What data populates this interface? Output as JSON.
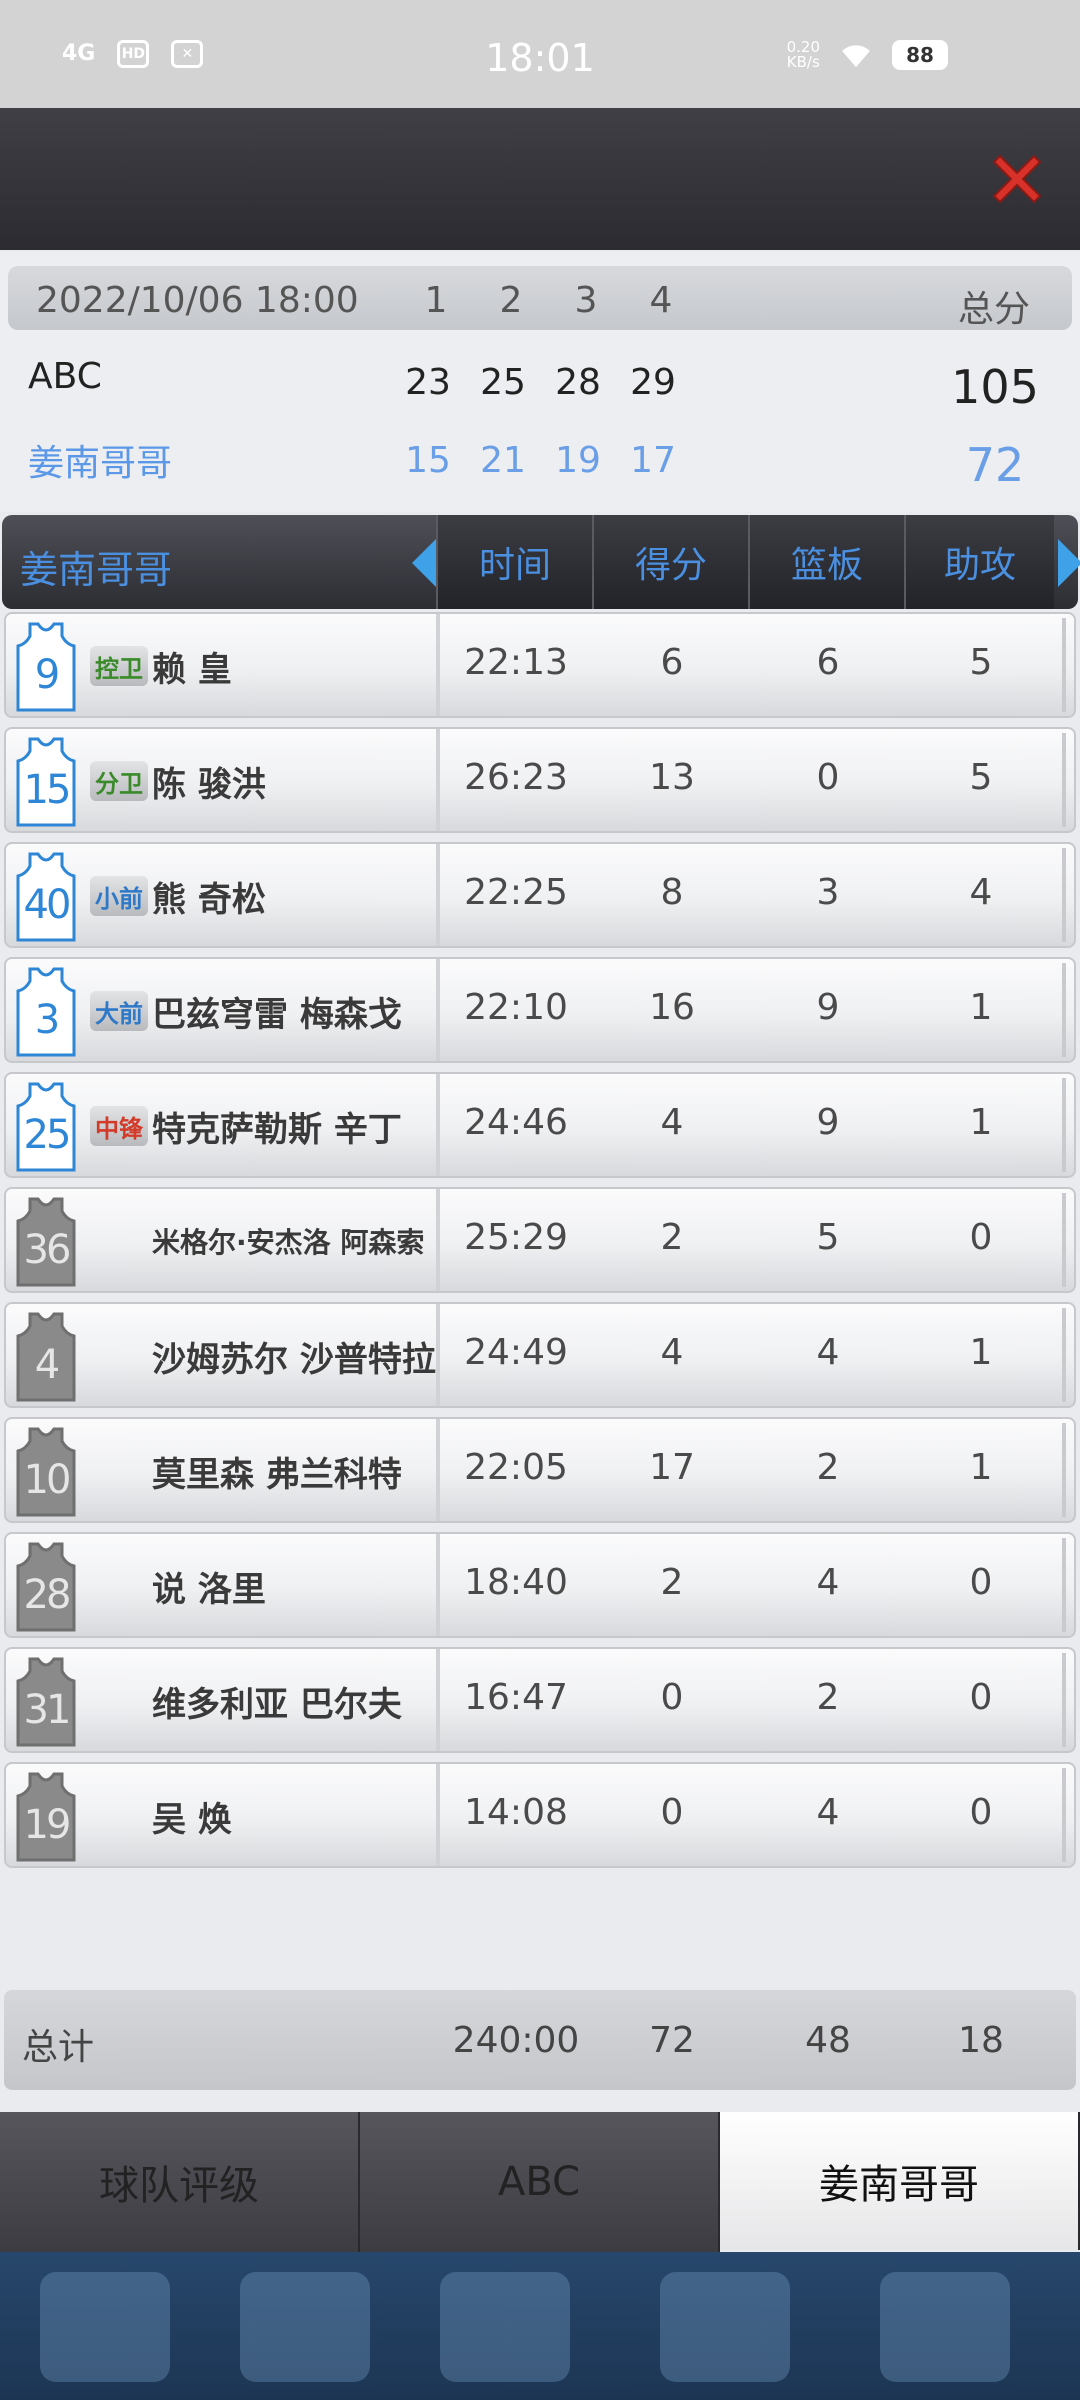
{
  "status_bar": {
    "network": "4G",
    "hd_label": "HD",
    "time": "18:01",
    "speed_value": "0.20",
    "speed_unit": "KB/s",
    "battery": "88"
  },
  "score_header": {
    "date": "2022/10/06 18:00",
    "quarters": [
      "1",
      "2",
      "3",
      "4"
    ],
    "total_label": "总分"
  },
  "teams": [
    {
      "name": "ABC",
      "quarters": [
        "23",
        "25",
        "28",
        "29"
      ],
      "total": "105"
    },
    {
      "name": "姜南哥哥",
      "quarters": [
        "15",
        "21",
        "19",
        "17"
      ],
      "total": "72"
    }
  ],
  "stats_header": {
    "team": "姜南哥哥",
    "columns": [
      "时间",
      "得分",
      "篮板",
      "助攻"
    ]
  },
  "players": [
    {
      "number": "9",
      "starter": true,
      "position": "控卫",
      "position_color": "#3a8a2a",
      "name": "赖 皇",
      "time": "22:13",
      "points": "6",
      "rebounds": "6",
      "assists": "5"
    },
    {
      "number": "15",
      "starter": true,
      "position": "分卫",
      "position_color": "#3a8a2a",
      "name": "陈 骏洪",
      "time": "26:23",
      "points": "13",
      "rebounds": "0",
      "assists": "5"
    },
    {
      "number": "40",
      "starter": true,
      "position": "小前",
      "position_color": "#2e78c8",
      "name": "熊 奇松",
      "time": "22:25",
      "points": "8",
      "rebounds": "3",
      "assists": "4"
    },
    {
      "number": "3",
      "starter": true,
      "position": "大前",
      "position_color": "#2e78c8",
      "name": "巴兹穹雷 梅森戈",
      "time": "22:10",
      "points": "16",
      "rebounds": "9",
      "assists": "1"
    },
    {
      "number": "25",
      "starter": true,
      "position": "中锋",
      "position_color": "#d33a2a",
      "name": "特克萨勒斯 辛丁",
      "time": "24:46",
      "points": "4",
      "rebounds": "9",
      "assists": "1"
    },
    {
      "number": "36",
      "starter": false,
      "position": "",
      "name": "米格尔·安杰洛 阿森索",
      "time": "25:29",
      "points": "2",
      "rebounds": "5",
      "assists": "0"
    },
    {
      "number": "4",
      "starter": false,
      "position": "",
      "name": "沙姆苏尔 沙普特拉",
      "time": "24:49",
      "points": "4",
      "rebounds": "4",
      "assists": "1"
    },
    {
      "number": "10",
      "starter": false,
      "position": "",
      "name": "莫里森 弗兰科特",
      "time": "22:05",
      "points": "17",
      "rebounds": "2",
      "assists": "1"
    },
    {
      "number": "28",
      "starter": false,
      "position": "",
      "name": "说 洛里",
      "time": "18:40",
      "points": "2",
      "rebounds": "4",
      "assists": "0"
    },
    {
      "number": "31",
      "starter": false,
      "position": "",
      "name": "维多利亚 巴尔夫",
      "time": "16:47",
      "points": "0",
      "rebounds": "2",
      "assists": "0"
    },
    {
      "number": "19",
      "starter": false,
      "position": "",
      "name": "吴 焕",
      "time": "14:08",
      "points": "0",
      "rebounds": "4",
      "assists": "0"
    }
  ],
  "totals": {
    "label": "总计",
    "time": "240:00",
    "points": "72",
    "rebounds": "48",
    "assists": "18"
  },
  "tabs": [
    {
      "label": "球队评级",
      "active": false
    },
    {
      "label": "ABC",
      "active": false
    },
    {
      "label": "姜南哥哥",
      "active": true
    }
  ],
  "colors": {
    "accent_blue": "#4a8fe0",
    "close_red": "#d8312a",
    "starter_jersey": "#2e86d6",
    "bench_jersey": "#8a8a8a"
  }
}
